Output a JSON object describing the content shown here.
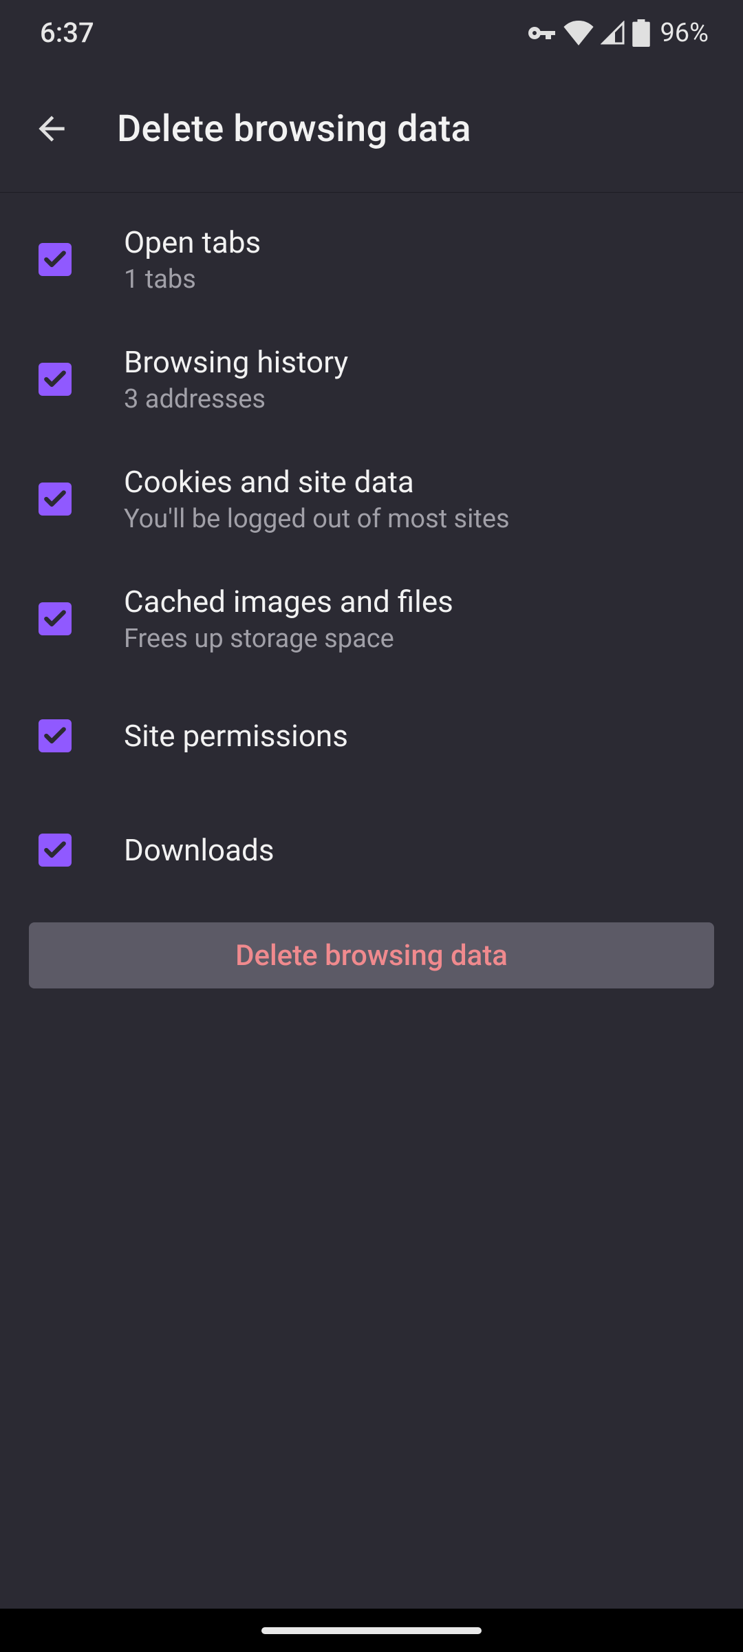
{
  "status": {
    "time": "6:37",
    "battery": "96%"
  },
  "appbar": {
    "title": "Delete browsing data"
  },
  "options": [
    {
      "title": "Open tabs",
      "subtitle": "1 tabs",
      "checked": true
    },
    {
      "title": "Browsing history",
      "subtitle": "3 addresses",
      "checked": true
    },
    {
      "title": "Cookies and site data",
      "subtitle": "You'll be logged out of most sites",
      "checked": true
    },
    {
      "title": "Cached images and files",
      "subtitle": "Frees up storage space",
      "checked": true
    },
    {
      "title": "Site permissions",
      "subtitle": "",
      "checked": true
    },
    {
      "title": "Downloads",
      "subtitle": "",
      "checked": true
    }
  ],
  "deleteButton": {
    "label": "Delete browsing data"
  }
}
